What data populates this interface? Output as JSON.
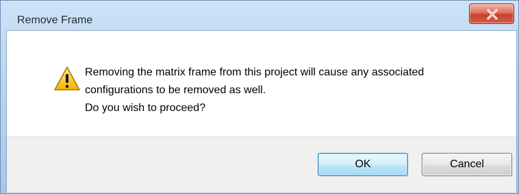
{
  "dialog": {
    "title": "Remove Frame",
    "close_icon": "close-x-icon",
    "icon": "warning-triangle-icon",
    "message_lines": [
      "Removing the matrix frame from this project will cause any associated",
      "configurations to be removed as well.",
      "Do you wish to proceed?"
    ],
    "buttons": {
      "ok_label": "OK",
      "cancel_label": "Cancel"
    }
  },
  "colors": {
    "titlebar": "#bcd5ef",
    "close_button": "#c8412e",
    "warning_yellow": "#f5c518",
    "footer": "#f0f0f0",
    "default_button_border": "#3c7fb1"
  }
}
